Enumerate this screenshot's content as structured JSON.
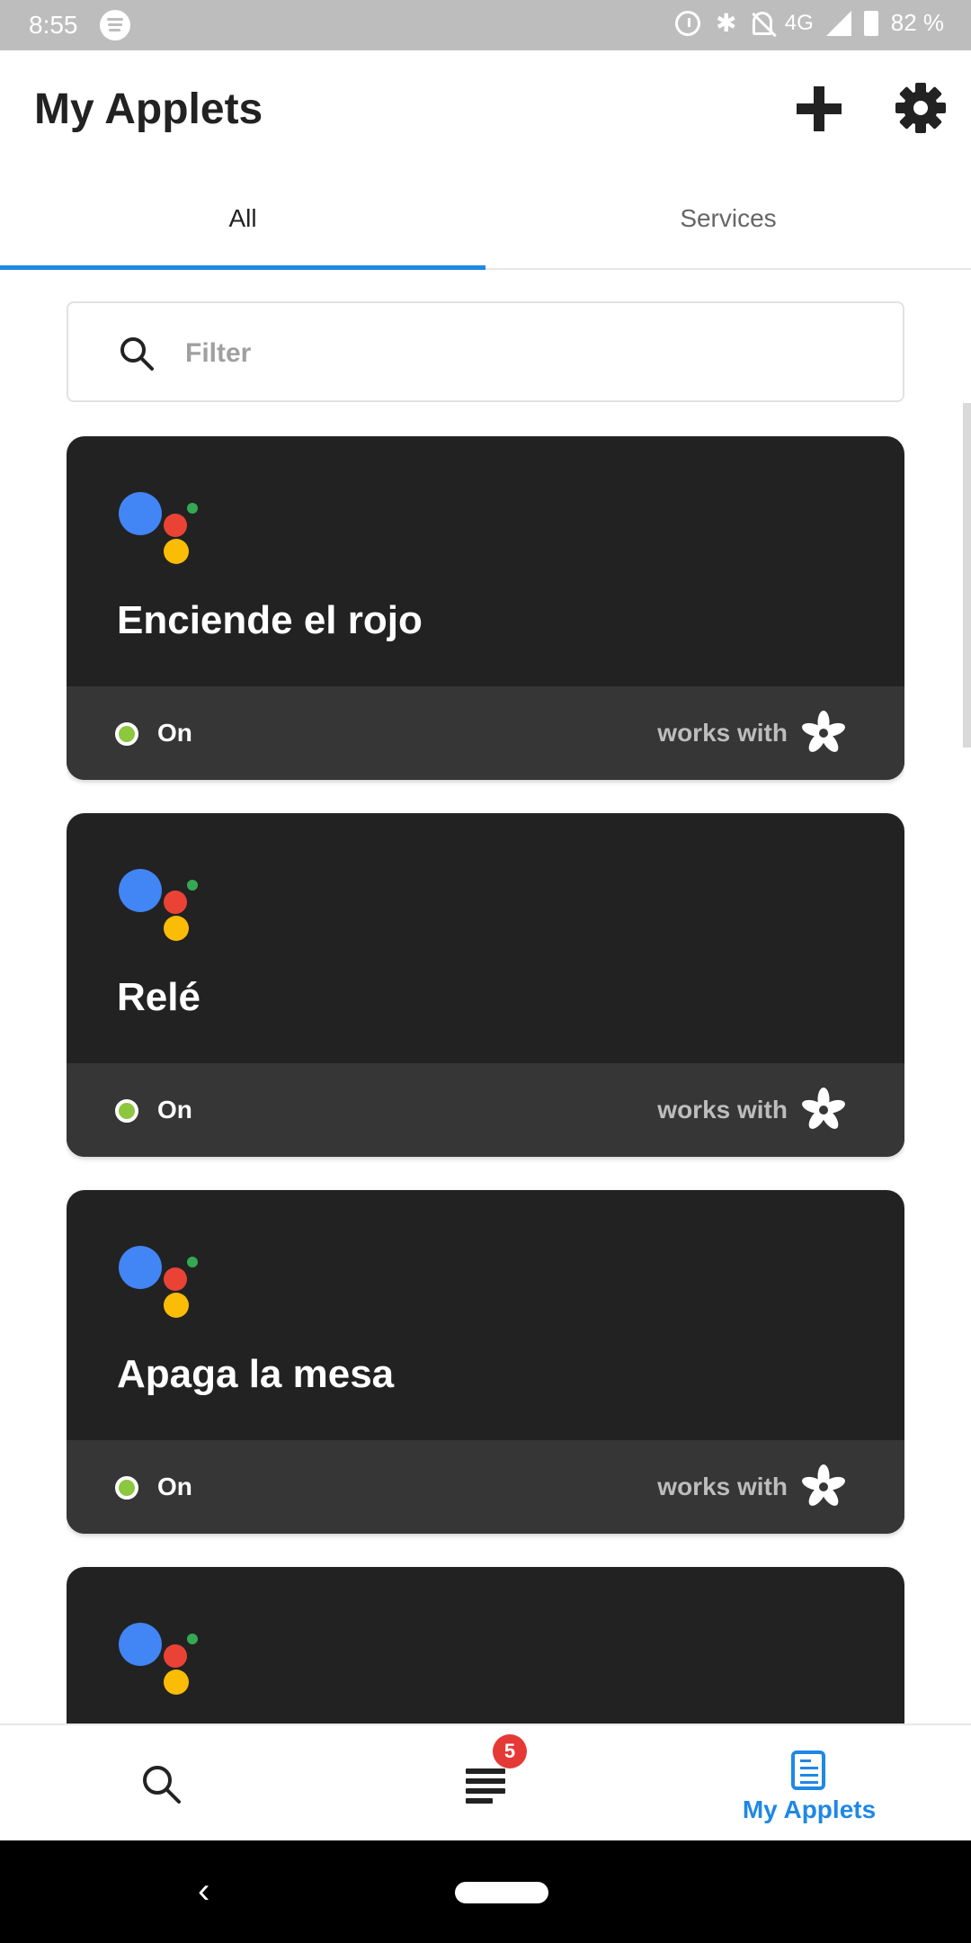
{
  "status_bar": {
    "time": "8:55",
    "network": "4G",
    "battery": "82 %",
    "icons": [
      "spotify-icon",
      "alarm-icon",
      "bluetooth-icon",
      "bell-off-icon",
      "signal-icon",
      "battery-icon"
    ]
  },
  "header": {
    "title": "My Applets",
    "actions": [
      "plus-icon",
      "gear-icon"
    ]
  },
  "tabs": [
    {
      "label": "All",
      "selected": true
    },
    {
      "label": "Services",
      "selected": false
    }
  ],
  "filter": {
    "placeholder": "Filter",
    "value": ""
  },
  "applets": [
    {
      "title": "Enciende el rojo",
      "status": "On",
      "works_with": "works with",
      "icon": "google-assistant-icon",
      "partner_icon": "adafruit-flower-icon"
    },
    {
      "title": "Relé",
      "status": "On",
      "works_with": "works with",
      "icon": "google-assistant-icon",
      "partner_icon": "adafruit-flower-icon"
    },
    {
      "title": "Apaga la mesa",
      "status": "On",
      "works_with": "works with",
      "icon": "google-assistant-icon",
      "partner_icon": "adafruit-flower-icon"
    },
    {
      "title": "",
      "status": "",
      "works_with": "",
      "icon": "google-assistant-icon",
      "partner_icon": ""
    }
  ],
  "bottom_nav": {
    "items": [
      {
        "label": "",
        "icon": "search-icon",
        "active": false
      },
      {
        "label": "",
        "icon": "activity-icon",
        "active": false,
        "badge": "5"
      },
      {
        "label": "My Applets",
        "icon": "applets-icon",
        "active": true
      }
    ]
  },
  "colors": {
    "accent": "#1e88e5",
    "card_bg": "#222222",
    "card_footer": "#363636",
    "status_on": "#8dc63f",
    "badge": "#e53935"
  }
}
